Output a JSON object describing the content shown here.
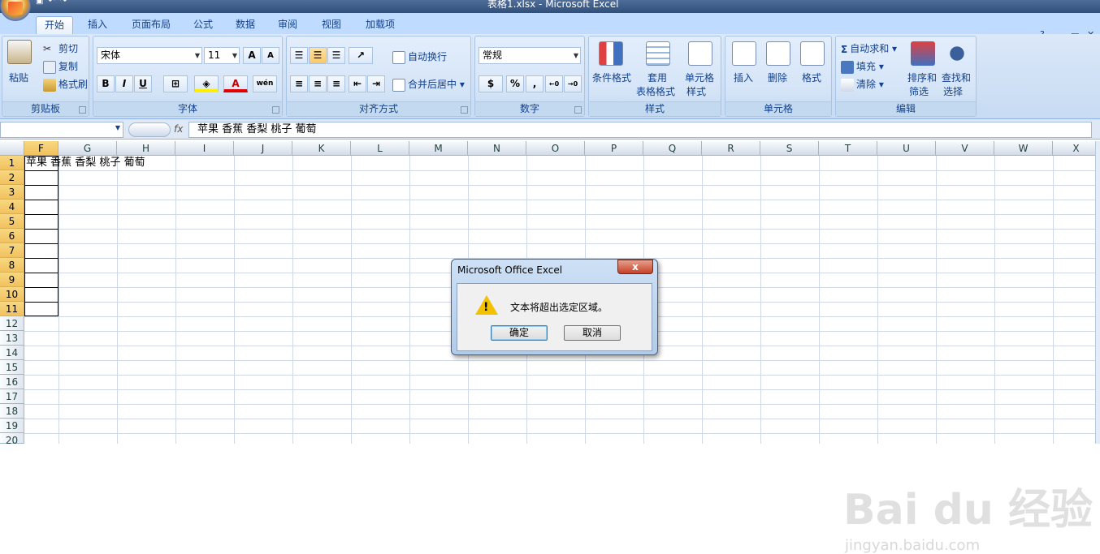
{
  "window": {
    "title": "表格1.xlsx - Microsoft Excel"
  },
  "tabs": [
    "开始",
    "插入",
    "页面布局",
    "公式",
    "数据",
    "审阅",
    "视图",
    "加载项"
  ],
  "ribbon": {
    "clipboard": {
      "label": "剪贴板",
      "paste": "粘贴",
      "cut": "剪切",
      "copy": "复制",
      "format_painter": "格式刷"
    },
    "font": {
      "label": "字体",
      "name": "宋体",
      "size": "11",
      "bold": "B",
      "italic": "I",
      "underline": "U",
      "grow": "A",
      "shrink": "A",
      "wen": "wén"
    },
    "alignment": {
      "label": "对齐方式",
      "wrap": "自动换行",
      "merge": "合并后居中"
    },
    "number": {
      "label": "数字",
      "format": "常规",
      "percent": "%",
      "comma": ","
    },
    "styles": {
      "label": "样式",
      "conditional": "条件格式",
      "table1": "套用",
      "table2": "表格格式",
      "cell1": "单元格",
      "cell2": "样式"
    },
    "cells": {
      "label": "单元格",
      "insert": "插入",
      "delete": "删除",
      "format": "格式"
    },
    "editing": {
      "label": "编辑",
      "autosum": "自动求和",
      "fill": "填充",
      "clear": "清除",
      "sort1": "排序和",
      "sort2": "筛选",
      "find1": "查找和",
      "find2": "选择"
    }
  },
  "formula_bar": {
    "fx": "fx",
    "content": "苹果 香蕉 香梨 桃子 葡萄"
  },
  "columns": [
    "F",
    "G",
    "H",
    "I",
    "J",
    "K",
    "L",
    "M",
    "N",
    "O",
    "P",
    "Q",
    "R",
    "S",
    "T",
    "U",
    "V",
    "W",
    "X"
  ],
  "rows": [
    "1",
    "2",
    "3",
    "4",
    "5",
    "6",
    "7",
    "8",
    "9",
    "10",
    "11",
    "12",
    "13",
    "14",
    "15",
    "16",
    "17",
    "18",
    "19",
    "20"
  ],
  "cell_text": "苹果 香蕉 香梨 桃子 葡萄",
  "dialog": {
    "title": "Microsoft Office Excel",
    "message": "文本将超出选定区域。",
    "ok": "确定",
    "cancel": "取消",
    "close": "x"
  },
  "watermark": {
    "brand": "Bai du 经验",
    "url": "jingyan.baidu.com"
  }
}
